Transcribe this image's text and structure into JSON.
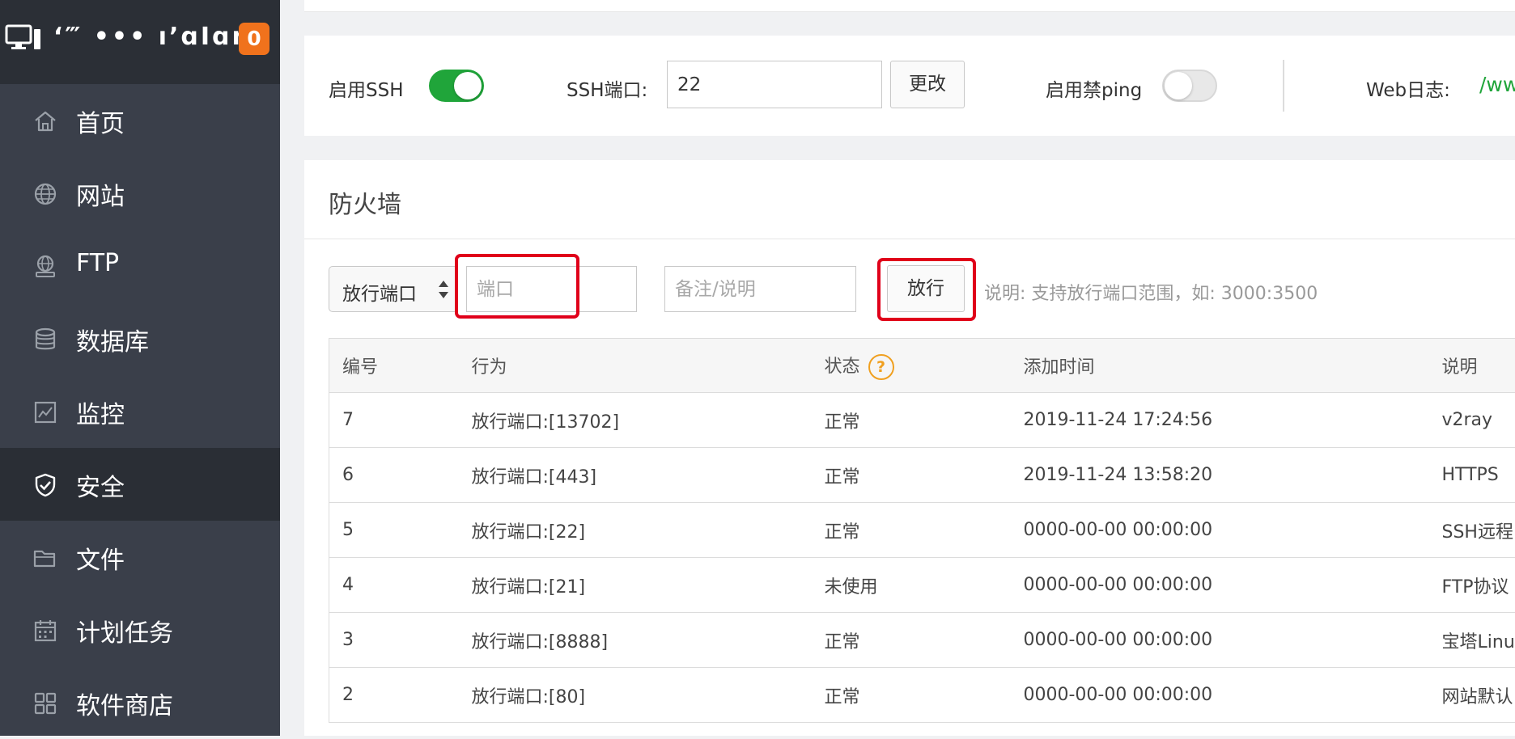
{
  "sidebar": {
    "brand_name": "‘‴ ••• ı’ɑΙɑn",
    "badge": "0",
    "items": [
      {
        "label": "首页",
        "icon": "home-icon"
      },
      {
        "label": "网站",
        "icon": "globe-icon"
      },
      {
        "label": "FTP",
        "icon": "ftp-icon"
      },
      {
        "label": "数据库",
        "icon": "database-icon"
      },
      {
        "label": "监控",
        "icon": "monitor-chart-icon"
      },
      {
        "label": "安全",
        "icon": "shield-check-icon",
        "active": true
      },
      {
        "label": "文件",
        "icon": "folder-icon"
      },
      {
        "label": "计划任务",
        "icon": "calendar-icon"
      },
      {
        "label": "软件商店",
        "icon": "app-grid-icon"
      }
    ]
  },
  "ssh": {
    "enable_label": "启用SSH",
    "enabled": true,
    "port_label": "SSH端口:",
    "port_value": "22",
    "change_button": "更改",
    "ping_label": "启用禁ping",
    "ping_enabled": false,
    "weblog_label": "Web日志:",
    "weblog_value": "/ww"
  },
  "firewall": {
    "title": "防火墙",
    "action_select": "放行端口",
    "port_placeholder": "端口",
    "note_placeholder": "备注/说明",
    "submit_button": "放行",
    "hint": "说明: 支持放行端口范围，如: 3000:3500",
    "columns": [
      "编号",
      "行为",
      "状态",
      "添加时间",
      "说明"
    ],
    "status_help": "?",
    "rows": [
      {
        "id": "7",
        "action": "放行端口:[13702]",
        "status": "正常",
        "time": "2019-11-24 17:24:56",
        "note": "v2ray"
      },
      {
        "id": "6",
        "action": "放行端口:[443]",
        "status": "正常",
        "time": "2019-11-24 13:58:20",
        "note": "HTTPS"
      },
      {
        "id": "5",
        "action": "放行端口:[22]",
        "status": "正常",
        "time": "0000-00-00 00:00:00",
        "note": "SSH远程"
      },
      {
        "id": "4",
        "action": "放行端口:[21]",
        "status": "未使用",
        "time": "0000-00-00 00:00:00",
        "note": "FTP协议"
      },
      {
        "id": "3",
        "action": "放行端口:[8888]",
        "status": "正常",
        "time": "0000-00-00 00:00:00",
        "note": "宝塔Linux"
      },
      {
        "id": "2",
        "action": "放行端口:[80]",
        "status": "正常",
        "time": "0000-00-00 00:00:00",
        "note": "网站默认"
      }
    ]
  },
  "colors": {
    "sidebar_bg": "#3a3f4a",
    "sidebar_active": "#2a2e35",
    "accent_green": "#20a53a",
    "badge_orange": "#f0721c",
    "highlight_red": "#e0001a"
  }
}
